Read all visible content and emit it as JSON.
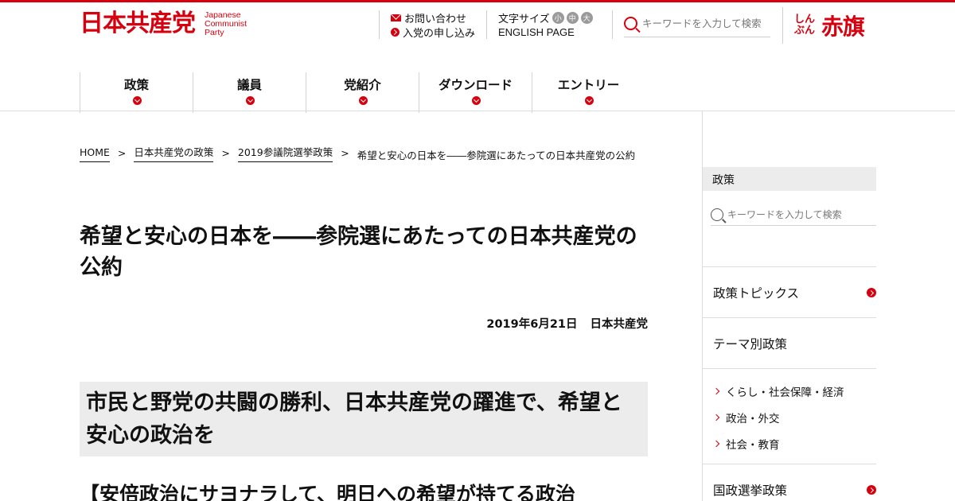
{
  "header": {
    "logo_jp": "日本共産党",
    "logo_en": [
      "Japanese",
      "Communist",
      "Party"
    ],
    "contact_label": "お問い合わせ",
    "join_label": "入党の申し込み",
    "font_size_label": "文字サイズ",
    "font_sizes": [
      "小",
      "中",
      "大"
    ],
    "english_label": "ENGLISH PAGE",
    "search_placeholder": "キーワードを入力して検索",
    "akahata_kana": "しんぶん",
    "akahata_kanji": "赤旗"
  },
  "nav": {
    "items": [
      {
        "label": "政策"
      },
      {
        "label": "議員"
      },
      {
        "label": "党紹介"
      },
      {
        "label": "ダウンロード"
      },
      {
        "label": "エントリー"
      }
    ]
  },
  "breadcrumb": {
    "items": [
      "HOME",
      "日本共産党の政策",
      "2019参議院選挙政策"
    ],
    "current": "希望と安心の日本を――参院選にあたっての日本共産党の公約",
    "separator": ">"
  },
  "article": {
    "title": "希望と安心の日本を――参院選にあたっての日本共産党の公約",
    "date": "2019年6月21日",
    "author": "日本共産党",
    "section_heading": "市民と野党の共闘の勝利、日本共産党の躍進で、希望と安心の政治を",
    "sub_heading": "【安倍政治にサヨナラして、明日への希望が持てる政治"
  },
  "sidebar": {
    "heading": "政策",
    "search_placeholder": "キーワードを入力して検索",
    "links": [
      {
        "label": "政策トピックス",
        "arrow": true
      },
      {
        "label": "テーマ別政策",
        "arrow": false
      }
    ],
    "sub_items": [
      "くらし・社会保障・経済",
      "政治・外交",
      "社会・教育"
    ],
    "bottom_link": "国政選挙政策"
  },
  "colors": {
    "brand_red": "#d7000f",
    "section_bg": "#ececec"
  }
}
